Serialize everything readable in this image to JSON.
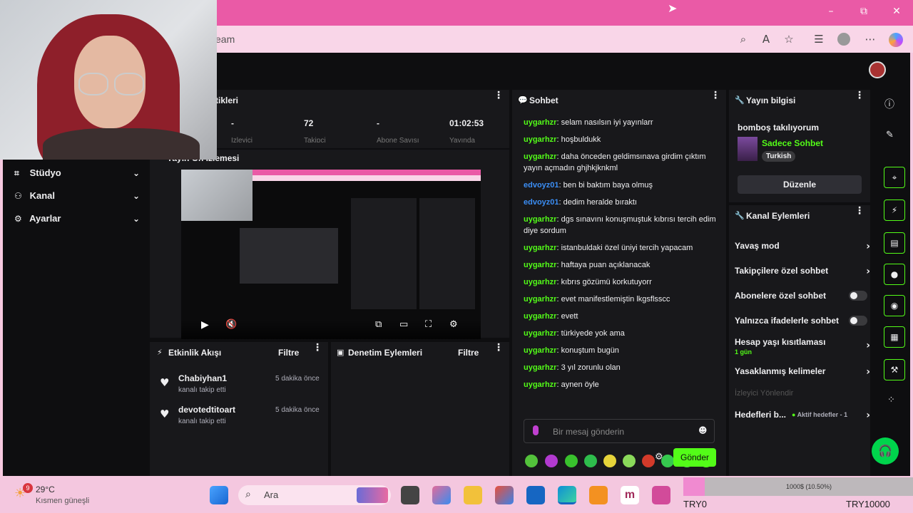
{
  "browser": {
    "url_fragment": "eam",
    "window_controls": {
      "minimize": "–",
      "maximize": "⧉",
      "close": "✕"
    }
  },
  "sidebar": {
    "items": [
      {
        "label": "Stüdyo",
        "icon": "studio-icon"
      },
      {
        "label": "Kanal",
        "icon": "channel-icon"
      },
      {
        "label": "Ayarlar",
        "icon": "settings-icon"
      }
    ]
  },
  "stats": {
    "title": "tikleri",
    "values": [
      "-",
      "72",
      "-",
      "01:02:53"
    ],
    "labels": [
      "İzleyici",
      "Takipçi",
      "Abone Sayısı",
      "Yayında"
    ]
  },
  "preview": {
    "title": "Yayın Ön İzlemesi"
  },
  "activity": {
    "title": "Etkinlik Akışı",
    "filter": "Filtre",
    "events": [
      {
        "user": "Chabiyhan1",
        "text": "kanalı takip etti",
        "time": "5 dakika önce"
      },
      {
        "user": "devotedtitoart",
        "text": "kanalı takip etti",
        "time": "5 dakika önce"
      }
    ]
  },
  "moderation": {
    "title": "Denetim Eylemleri",
    "filter": "Filtre"
  },
  "chat": {
    "title": "Sohbet",
    "messages": [
      {
        "user": "uygarhzr",
        "color": "#53fc18",
        "text": "selam nasılsın iyi yayınlarr"
      },
      {
        "user": "uygarhzr",
        "color": "#53fc18",
        "text": "hoşbuldukk"
      },
      {
        "user": "uygarhzr",
        "color": "#53fc18",
        "text": "daha önceden geldimsınava girdim çıktım yayın açmadın ghjhkjknkml"
      },
      {
        "user": "edvoyz01",
        "color": "#3b8ef5",
        "text": "ben bi baktım baya olmuş"
      },
      {
        "user": "edvoyz01",
        "color": "#3b8ef5",
        "text": "dedim heralde bıraktı"
      },
      {
        "user": "uygarhzr",
        "color": "#53fc18",
        "text": "dgs sınavını konuşmuştuk kıbrısı tercih edim diye sordum"
      },
      {
        "user": "uygarhzr",
        "color": "#53fc18",
        "text": "istanbuldaki özel üniyi tercih yapacam"
      },
      {
        "user": "uygarhzr",
        "color": "#53fc18",
        "text": "haftaya puan açıklanacak"
      },
      {
        "user": "uygarhzr",
        "color": "#53fc18",
        "text": "kıbrıs gözümü korkutuyorr"
      },
      {
        "user": "uygarhzr",
        "color": "#53fc18",
        "text": "evet manifestlemiştin lkgsflsscc"
      },
      {
        "user": "uygarhzr",
        "color": "#53fc18",
        "text": "evett"
      },
      {
        "user": "uygarhzr",
        "color": "#53fc18",
        "text": "türkiyede yok ama"
      },
      {
        "user": "uygarhzr",
        "color": "#53fc18",
        "text": "konuştum bugün"
      },
      {
        "user": "uygarhzr",
        "color": "#53fc18",
        "text": "3 yıl zorunlu olan"
      },
      {
        "user": "uygarhzr",
        "color": "#53fc18",
        "text": "aynen öyle"
      }
    ],
    "input_placeholder": "Bir mesaj gönderin",
    "send_label": "Gönder"
  },
  "stream_info": {
    "title": "Yayın bilgisi",
    "stream_title": "bomboş takılıyorum",
    "category": "Sadece Sohbet",
    "tag": "Turkish",
    "edit_label": "Düzenle"
  },
  "channel_actions": {
    "title": "Kanal Eylemleri",
    "rows": [
      {
        "label": "Yavaş mod",
        "type": "arrow"
      },
      {
        "label": "Takipçilere özel sohbet",
        "type": "arrow"
      },
      {
        "label": "Abonelere özel sohbet",
        "type": "toggle"
      },
      {
        "label": "Yalnızca ifadelerle sohbet",
        "type": "toggle"
      },
      {
        "label": "Hesap yaşı kısıtlaması",
        "sub": "1 gün",
        "type": "arrow"
      },
      {
        "label": "Yasaklanmış kelimeler",
        "type": "arrow"
      }
    ],
    "host_label": "İzleyici Yönlendir",
    "goals_label": "Hedefleri b...",
    "goals_sub": "Aktif hedefler - 1"
  },
  "taskbar": {
    "weather_temp": "29°C",
    "weather_desc": "Kısmen güneşli",
    "weather_badge": "9",
    "search_label": "Ara",
    "tray_progress": "1000$ (10.50%)",
    "try_left": "TRY0",
    "try_right": "TRY10000"
  },
  "colors": {
    "accent": "#53fc18",
    "chrome_pink": "#ea5aa6",
    "panel": "#18181b"
  }
}
